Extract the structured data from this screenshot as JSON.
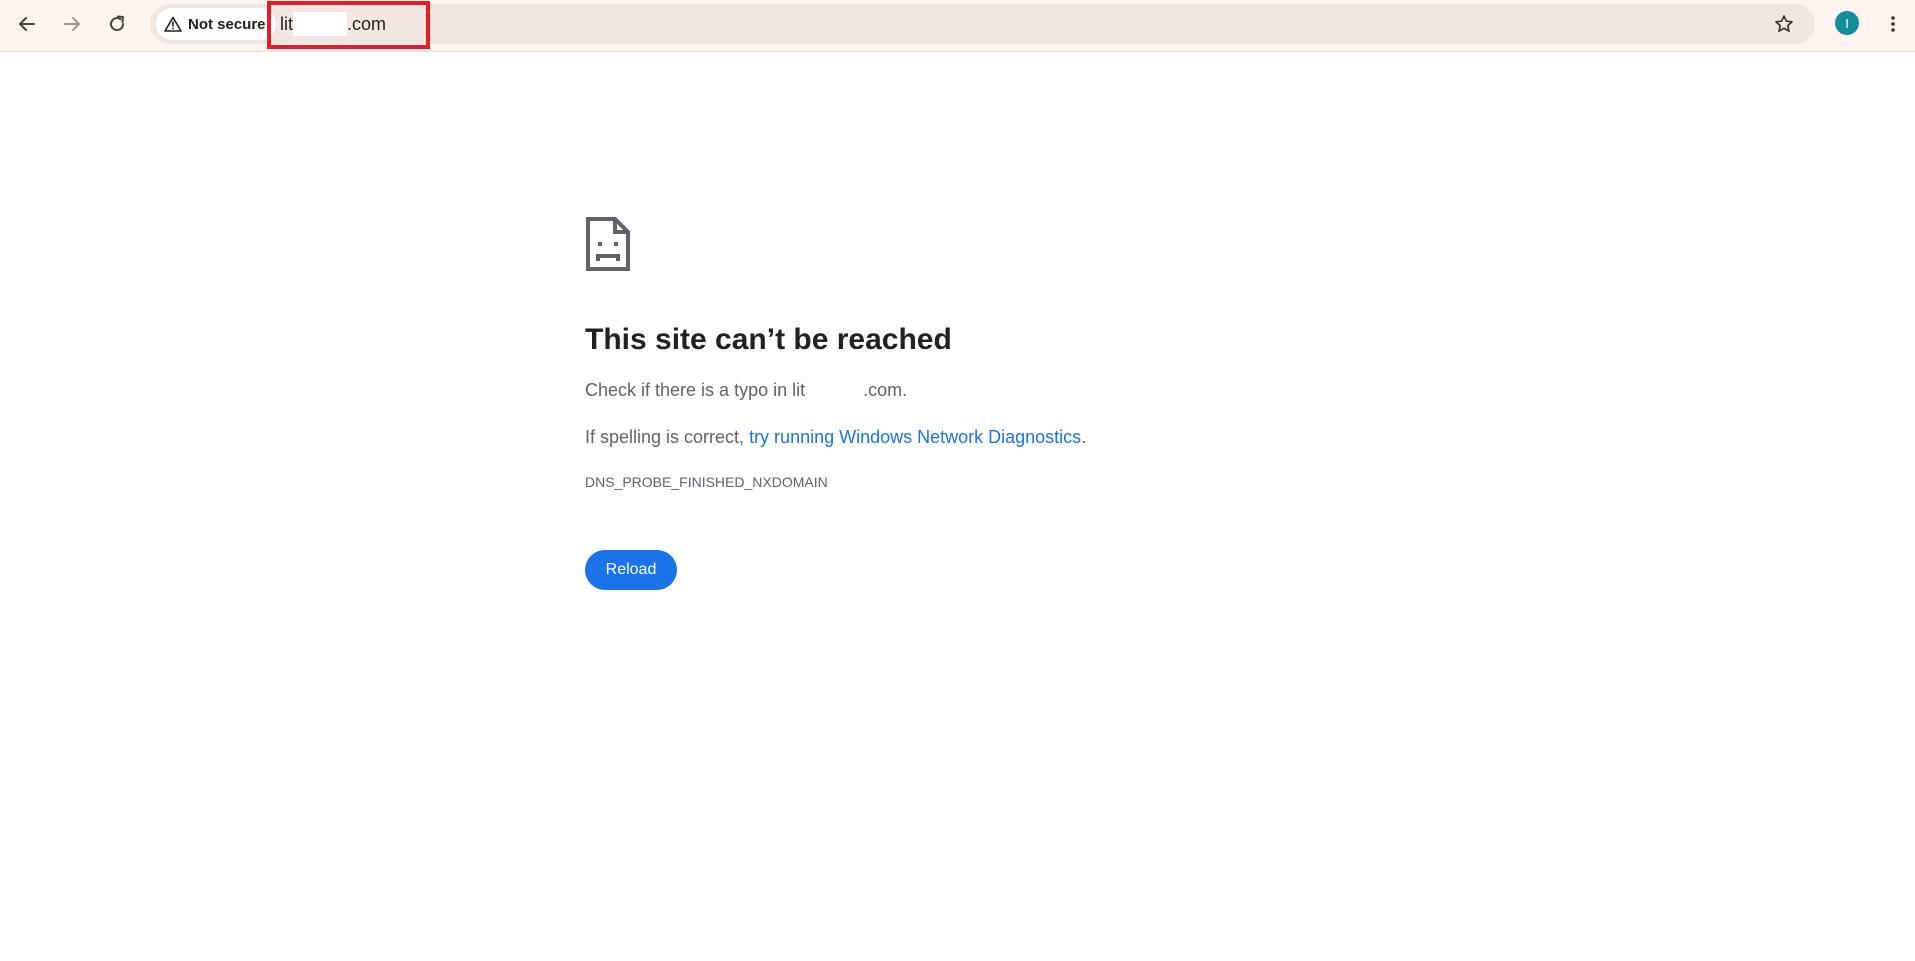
{
  "browser": {
    "security_label": "Not secure",
    "url_prefix": "lit",
    "url_suffix": ".com",
    "profile_initial": "I",
    "colors": {
      "toolbar_bg": "#fdf3ef",
      "omnibox_bg": "#f1e6e2",
      "avatar": "#138d9c",
      "highlight": "#e41e26"
    },
    "icons": [
      "back-arrow-icon",
      "forward-arrow-icon",
      "reload-icon",
      "warning-icon",
      "star-icon",
      "more-vert-icon"
    ]
  },
  "error_page": {
    "icon": "sad-page-icon",
    "title": "This site can’t be reached",
    "typo_prefix": "Check if there is a typo in lit",
    "typo_suffix": ".com.",
    "spelling_prefix": "If spelling is correct, ",
    "diagnostics_link": "try running Windows Network Diagnostics",
    "spelling_suffix": ".",
    "error_code": "DNS_PROBE_FINISHED_NXDOMAIN",
    "reload_label": "Reload",
    "colors": {
      "link": "#1a73e8",
      "button": "#1a73e8",
      "title": "#202124",
      "body_text": "#5f6368"
    }
  }
}
